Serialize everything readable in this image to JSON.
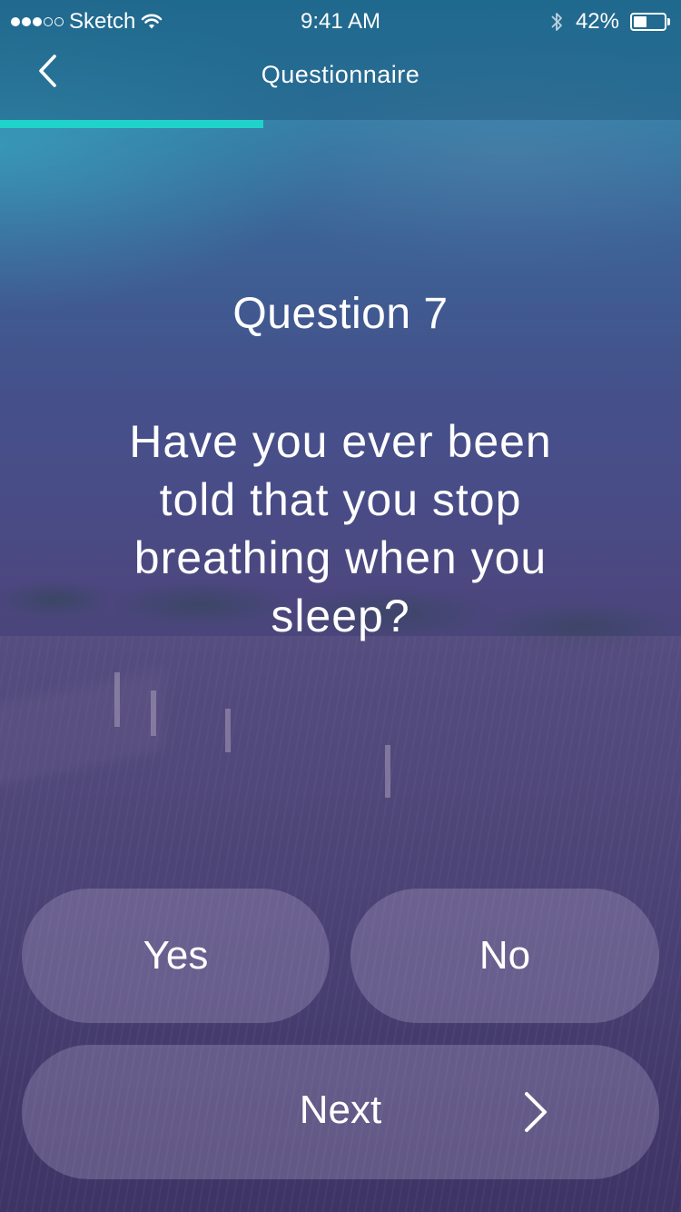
{
  "status_bar": {
    "carrier": "Sketch",
    "signal_bars_filled": 3,
    "signal_bars_total": 5,
    "time": "9:41 AM",
    "battery_percent": "42%"
  },
  "nav": {
    "title": "Questionnaire",
    "progress": 0.387
  },
  "question": {
    "number_label": "Question 7",
    "text": "Have you ever been told that you stop breathing when you sleep?"
  },
  "answers": {
    "yes_label": "Yes",
    "no_label": "No"
  },
  "footer": {
    "next_label": "Next"
  },
  "colors": {
    "accent": "#1fd3cb",
    "text": "#ffffff"
  }
}
